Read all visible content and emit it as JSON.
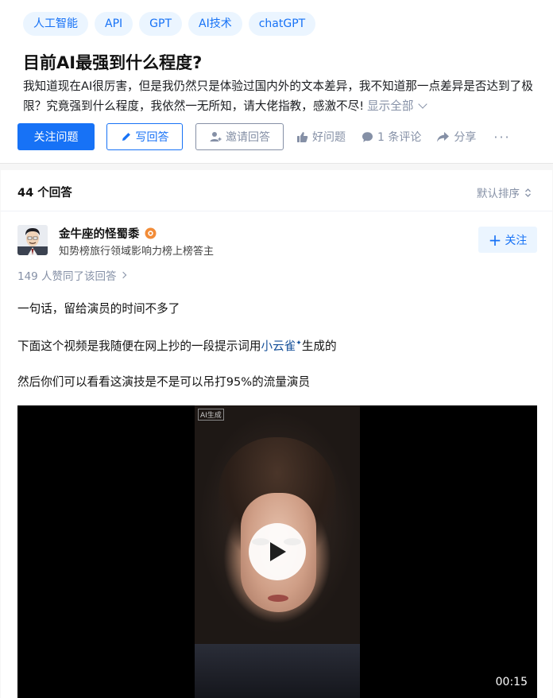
{
  "question": {
    "tags": [
      "人工智能",
      "API",
      "GPT",
      "AI技术",
      "chatGPT"
    ],
    "title": "目前AI最强到什么程度?",
    "description": "我知道现在AI很厉害，但是我仍然只是体验过国内外的文本差异，我不知道那一点差异是否达到了极限？究竟强到什么程度，我依然一无所知，请大佬指教，感激不尽!",
    "show_all": "显示全部",
    "actions": {
      "follow": "关注问题",
      "write": "写回答",
      "invite": "邀请回答",
      "good_question": "好问题",
      "comments": "1 条评论",
      "share": "分享",
      "more": "···"
    }
  },
  "answers": {
    "count_label": "44 个回答",
    "sort_label": "默认排序",
    "author": {
      "name": "金牛座的怪蜀黍",
      "intro": "知势榜旅行领域影响力榜上榜答主",
      "follow_label": "关注"
    },
    "voters": "149 人赞同了该回答",
    "paragraphs": {
      "p1": "一句话，留给演员的时间不多了",
      "p2_prefix": "下面这个视频是我随便在网上抄的一段提示词用",
      "p2_keyword": "小云雀",
      "p2_suffix": "生成的",
      "p3": "然后你们可以看看这演技是不是可以吊打95%的流量演员"
    },
    "video": {
      "watermark": "AI生成",
      "duration": "00:15"
    }
  },
  "colors": {
    "brand_blue": "#1772f6",
    "muted": "#8590a6",
    "tag_bg": "#ebf5ff",
    "badge_orange": "#f28c38"
  }
}
